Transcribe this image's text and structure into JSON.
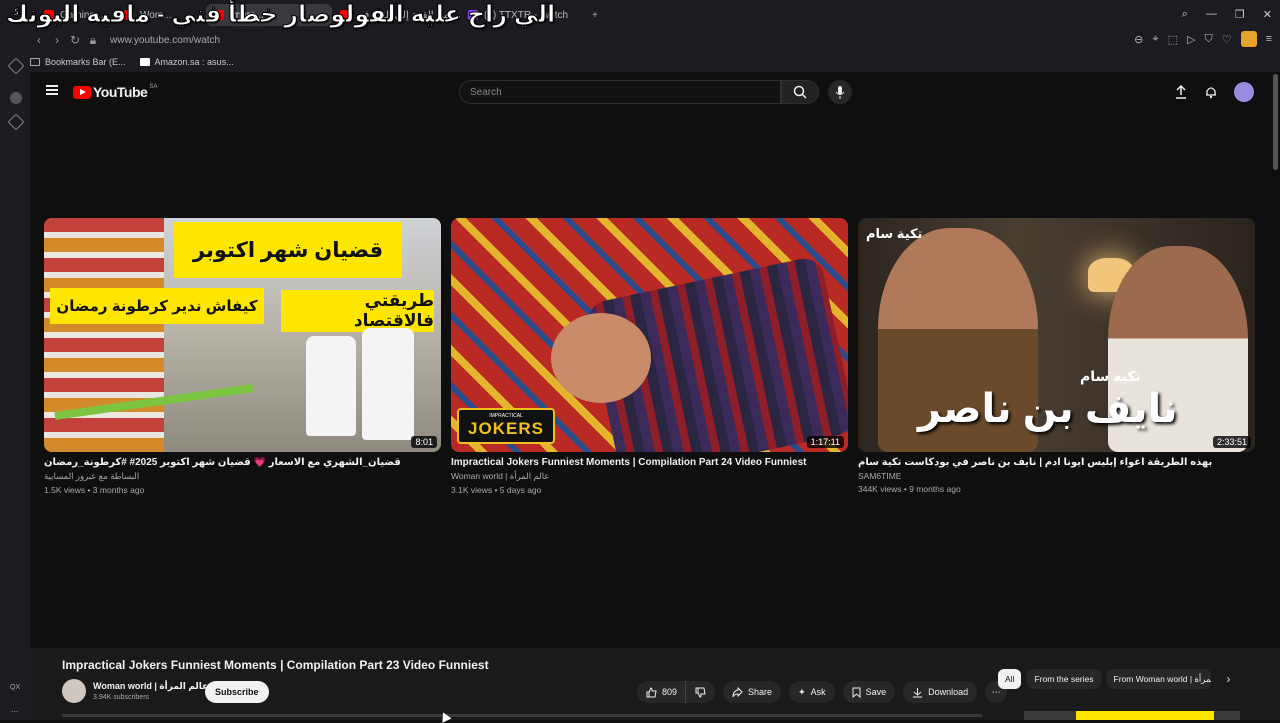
{
  "browser": {
    "tabs": [
      {
        "label": "Gaming...",
        "color": "#ff0000",
        "active": false
      },
      {
        "label": "Wom...",
        "color": "#ff0000",
        "active": false
      },
      {
        "label": "Impra...",
        "color": "#ff0000",
        "active": true
      },
      {
        "label": "ديكي من القمة إلى القاع في",
        "color": "#ff0000",
        "active": false
      },
      {
        "label": "(1) TTXTR - Twitch",
        "color": "#9146ff",
        "active": false
      }
    ],
    "new_tab": "+",
    "url": "www.youtube.com/watch",
    "bookmarks": [
      "Bookmarks Bar (E...",
      "Amazon.sa : asus..."
    ]
  },
  "overlay_caption": "الي راح عليه الفولوصار خطأ فني - مافيه اليونك",
  "yt": {
    "logo": "YouTube",
    "region": "SA",
    "search_placeholder": "Search"
  },
  "videos": [
    {
      "title": "قضيان_الشهري مع الاسعار 💗 قضيان شهر اكتوبر 2025# #كرطونة_رمضان",
      "channel": "البساطة مع عبرور المسابية",
      "meta": "1.5K views • 3 months ago",
      "duration": "8:01",
      "thumb_text": [
        "قضيان شهر اكتوبر",
        "كيفاش ندير كرطونة رمضان",
        "طريقتي فالاقتصاد"
      ]
    },
    {
      "title": "Impractical Jokers Funniest Moments | Compilation Part 24 Video Funniest",
      "channel": "Woman world | عالم المرأة",
      "meta": "3.1K views • 5 days ago",
      "duration": "1:17:11",
      "thumb_text": [
        "IMPRACTICAL",
        "JOKERS"
      ]
    },
    {
      "title": "بهذه الطريقة اغواء إبليس ايونا ادم | نايف بن ناصر في بودكاست تكية سام",
      "channel": "SAM6TIME",
      "meta": "344K views • 9 months ago",
      "duration": "2:33:51",
      "thumb_text": [
        "نايف بن ناصر",
        "تكية سام",
        "تكية سام"
      ]
    }
  ],
  "player": {
    "title": "Impractical Jokers Funniest Moments | Compilation Part 23 Video Funniest",
    "channel": "Woman world | عالم المرأة",
    "subscribers": "3.94K subscribers",
    "subscribe_label": "Subscribe",
    "likes": "809",
    "share": "Share",
    "ask": "Ask",
    "save": "Save",
    "download": "Download",
    "chips": [
      "All",
      "From the series",
      "From Woman world | عالم المرأة"
    ]
  },
  "sidebar_labels": {
    "qx": "QX",
    "more": "..."
  }
}
